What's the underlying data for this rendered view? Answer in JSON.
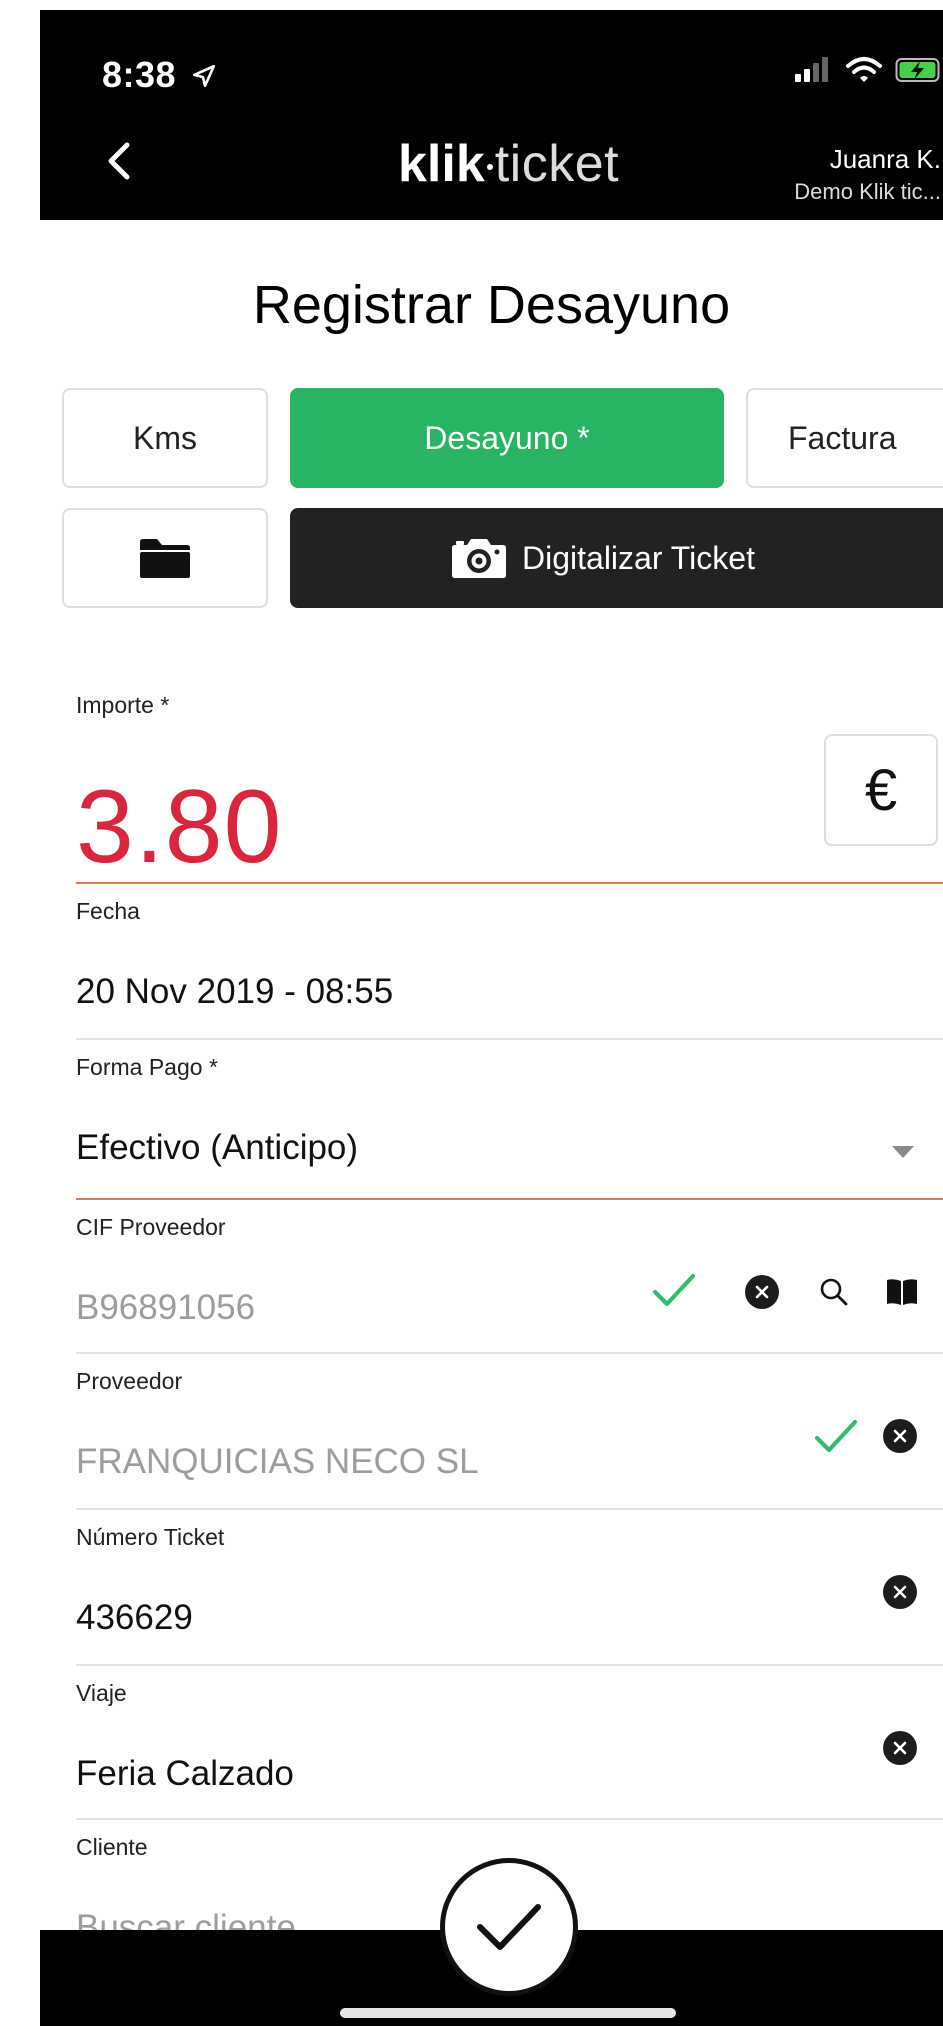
{
  "status_bar": {
    "time": "8:38"
  },
  "header": {
    "brand_bold": "klik",
    "brand_light": "ticket",
    "user_name": "Juanra K.",
    "company": "Demo Klik tic..."
  },
  "page": {
    "title": "Registrar Desayuno"
  },
  "type_buttons": {
    "kms": "Kms",
    "desayuno": "Desayuno *",
    "factura": "Factura",
    "digitalizar": "Digitalizar Ticket"
  },
  "fields": {
    "importe": {
      "label": "Importe *",
      "value": "3.80",
      "currency": "€"
    },
    "fecha": {
      "label": "Fecha",
      "value": "20 Nov 2019 - 08:55"
    },
    "forma_pago": {
      "label": "Forma Pago *",
      "value": "Efectivo (Anticipo)"
    },
    "cif": {
      "label": "CIF Proveedor",
      "value": "B96891056"
    },
    "proveedor": {
      "label": "Proveedor",
      "value": "FRANQUICIAS NECO SL"
    },
    "numero_ticket": {
      "label": "Número Ticket",
      "value": "436629"
    },
    "viaje": {
      "label": "Viaje",
      "value": "Feria Calzado"
    },
    "cliente": {
      "label": "Cliente",
      "placeholder": "Buscar cliente"
    }
  },
  "colors": {
    "accent_green": "#28b463",
    "importe_red": "#d9263e",
    "underline_accent": "#e07b5a",
    "check_green": "#2ebd6b"
  }
}
